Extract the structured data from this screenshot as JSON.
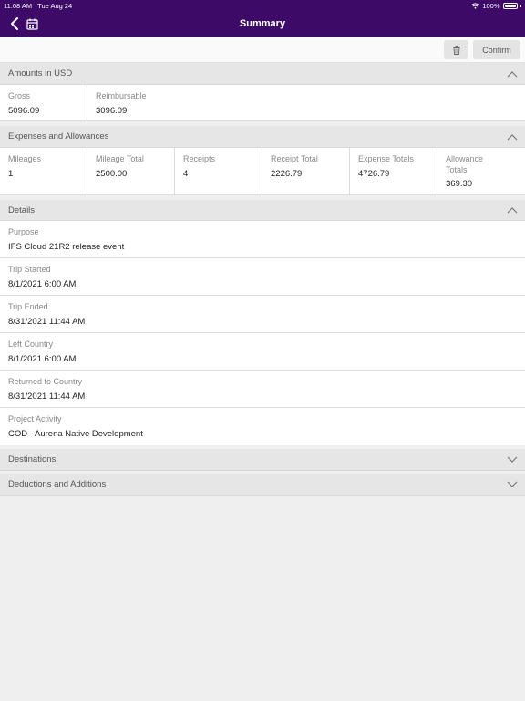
{
  "status_bar": {
    "time": "11:08 AM",
    "date": "Tue Aug 24",
    "battery": "100%"
  },
  "nav": {
    "title": "Summary"
  },
  "toolbar": {
    "confirm_label": "Confirm"
  },
  "amounts": {
    "title": "Amounts in USD",
    "cells": [
      {
        "label": "Gross",
        "value": "5096.09"
      },
      {
        "label": "Reimbursable",
        "value": "3096.09"
      }
    ]
  },
  "expenses": {
    "title": "Expenses and Allowances",
    "cells": [
      {
        "label": "Mileages",
        "value": "1"
      },
      {
        "label": "Mileage Total",
        "value": "2500.00"
      },
      {
        "label": "Receipts",
        "value": "4"
      },
      {
        "label": "Receipt Total",
        "value": "2226.79"
      },
      {
        "label": "Expense Totals",
        "value": "4726.79"
      },
      {
        "label": "Allowance Totals",
        "value": "369.30"
      }
    ]
  },
  "details": {
    "title": "Details",
    "fields": [
      {
        "label": "Purpose",
        "value": "IFS Cloud 21R2 release event"
      },
      {
        "label": "Trip Started",
        "value": "8/1/2021 6:00 AM"
      },
      {
        "label": "Trip Ended",
        "value": "8/31/2021 11:44 AM"
      },
      {
        "label": "Left Country",
        "value": "8/1/2021 6:00 AM"
      },
      {
        "label": "Returned to Country",
        "value": "8/31/2021 11:44 AM"
      },
      {
        "label": "Project Activity",
        "value": "COD - Aurena Native Development"
      }
    ]
  },
  "destinations": {
    "title": "Destinations"
  },
  "deductions": {
    "title": "Deductions and Additions"
  },
  "colors": {
    "nav_bg": "#3d0b67",
    "section_bg": "#e6e6e7",
    "page_bg": "#efeff0"
  }
}
